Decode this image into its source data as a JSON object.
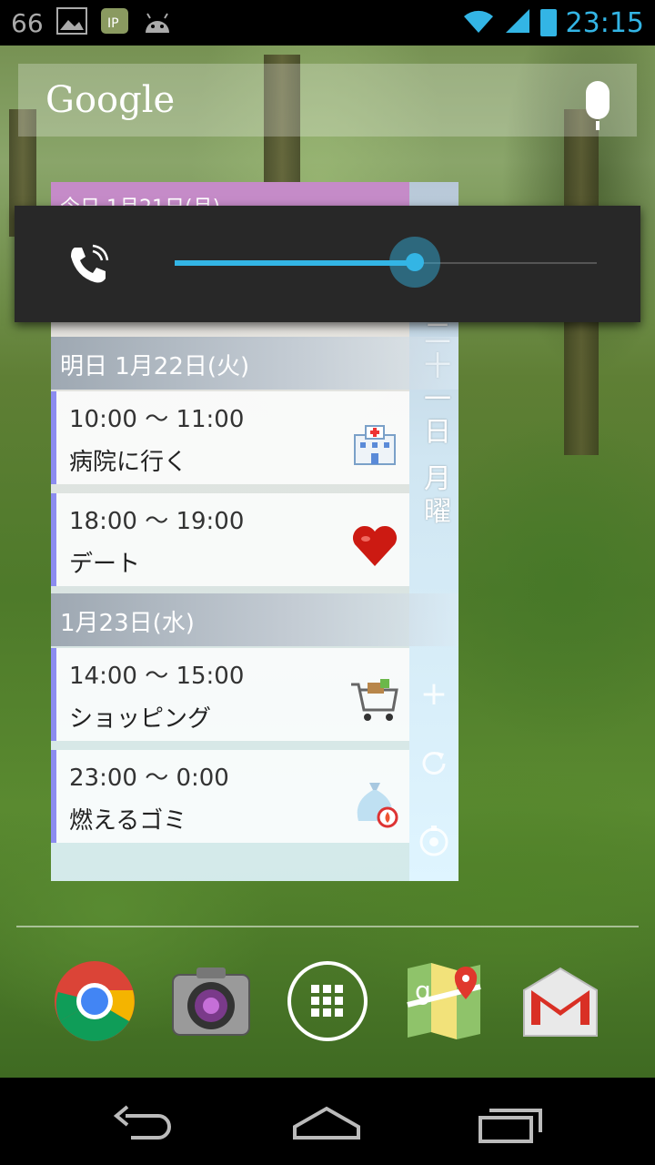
{
  "status_bar": {
    "left_number": "66",
    "time": "23:15",
    "accent_color": "#33b5e5",
    "icons": [
      "image-icon",
      "ip-icon",
      "android-icon",
      "wifi-icon",
      "signal-icon",
      "battery-charging-icon"
    ]
  },
  "search": {
    "logo_text": "Google"
  },
  "calendar_widget": {
    "today_header": "今日 1月21日(月)",
    "vertical_date": "二十一日 月曜",
    "sections": [
      {
        "header": "明日 1月22日(火)",
        "events": [
          {
            "time": "10:00 ～ 11:00",
            "title": "病院に行く",
            "icon": "hospital-icon"
          },
          {
            "time": "18:00 ～ 19:00",
            "title": "デート",
            "icon": "heart-icon"
          }
        ]
      },
      {
        "header": "1月23日(水)",
        "events": [
          {
            "time": "14:00 ～ 15:00",
            "title": "ショッピング",
            "icon": "shopping-cart-icon"
          },
          {
            "time": "23:00 ～ 0:00",
            "title": "燃えるゴミ",
            "icon": "garbage-bag-icon"
          }
        ]
      }
    ],
    "side_buttons": [
      "add-icon",
      "refresh-icon",
      "settings-icon"
    ]
  },
  "volume": {
    "stream_icon": "ringer-phone-icon",
    "level_fraction": 0.57
  },
  "dock": {
    "apps": [
      "chrome-icon",
      "camera-icon",
      "app-drawer-icon",
      "maps-icon",
      "gmail-icon"
    ]
  },
  "nav": {
    "buttons": [
      "back-icon",
      "home-icon",
      "recents-icon"
    ]
  }
}
